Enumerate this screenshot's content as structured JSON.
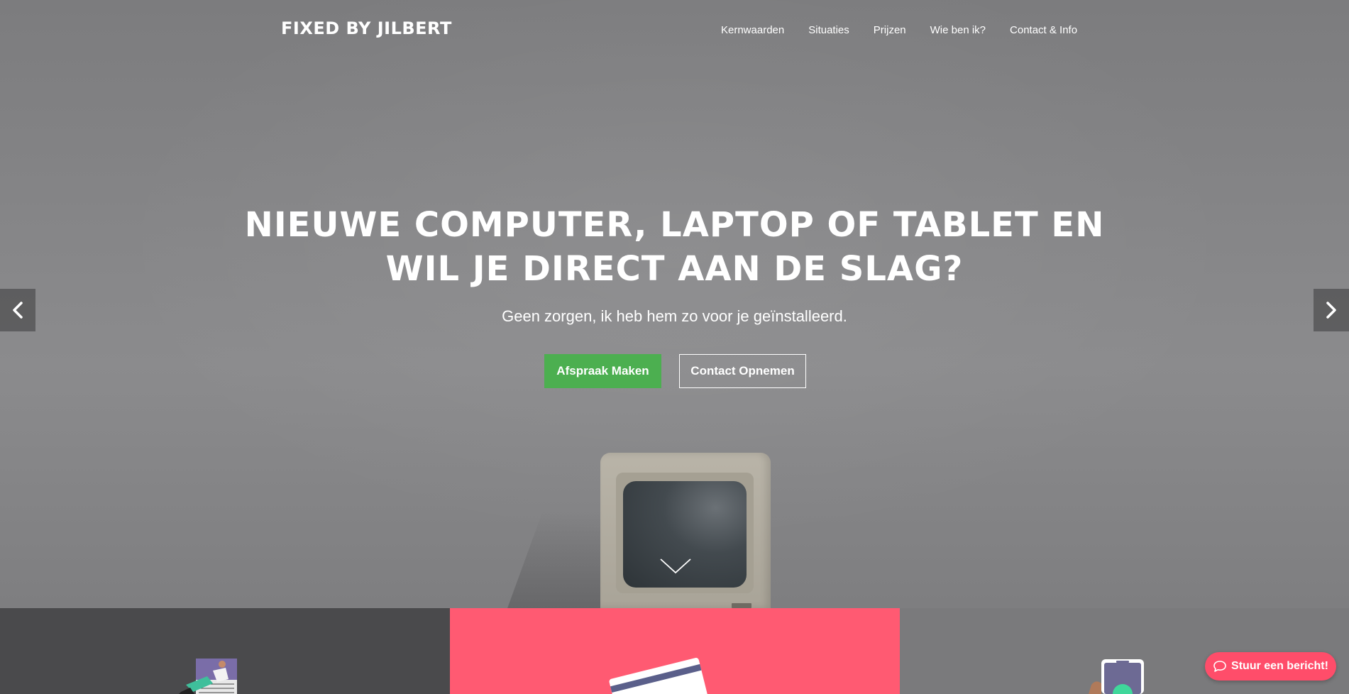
{
  "header": {
    "brand": "FIXED BY JILBERT",
    "nav": [
      {
        "label": "Kernwaarden"
      },
      {
        "label": "Situaties"
      },
      {
        "label": "Prijzen"
      },
      {
        "label": "Wie ben ik?"
      },
      {
        "label": "Contact & Info"
      }
    ]
  },
  "hero": {
    "headline_line1": "NIEUWE COMPUTER, LAPTOP OF TABLET EN",
    "headline_line2": "WIL JE DIRECT AAN DE SLAG?",
    "subline": "Geen zorgen, ik heb hem zo voor je geïnstalleerd.",
    "primary_button": "Afspraak Maken",
    "secondary_button": "Contact Opnemen",
    "icons": {
      "prev": "chevron-left-icon",
      "next": "chevron-right-icon",
      "scroll": "chevron-down-icon"
    }
  },
  "colors": {
    "primary_button": "#4caf50",
    "accent_pink": "#ff5a72",
    "panel_dark": "#4a4a4c",
    "panel_grey": "#7a7a7c",
    "chat_button": "#ff4d6a"
  },
  "chat": {
    "label": "Stuur een bericht!",
    "icon": "speech-bubble-icon"
  }
}
